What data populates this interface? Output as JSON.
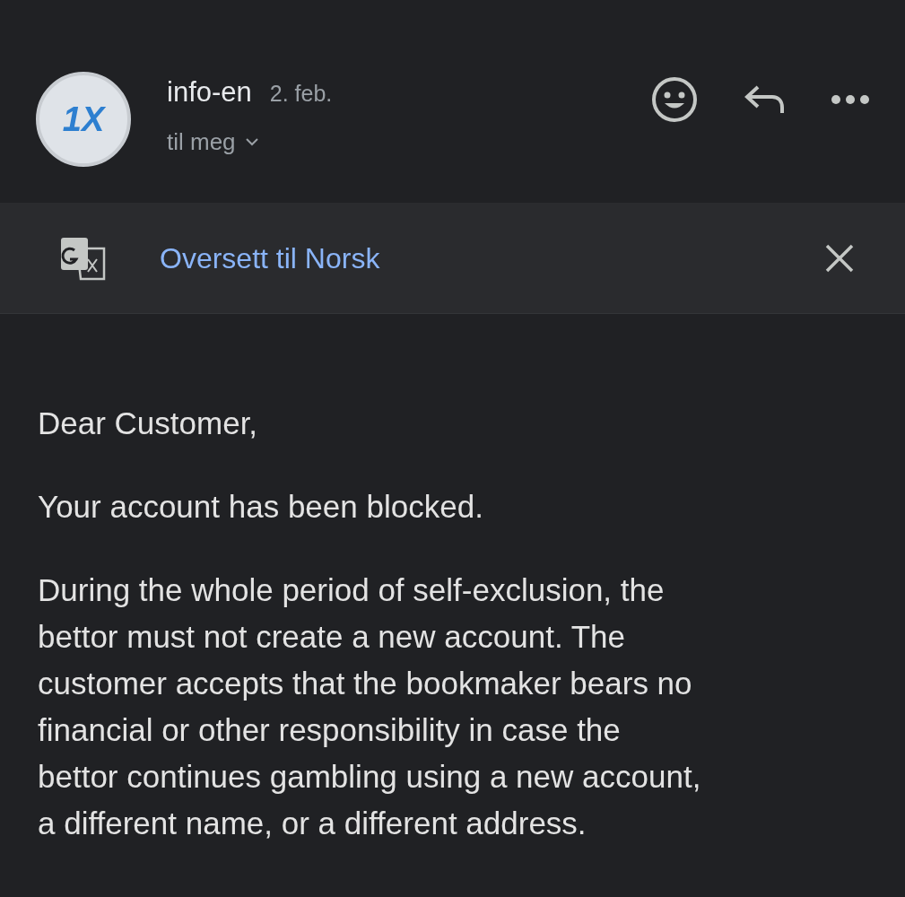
{
  "header": {
    "avatar_text": "1X",
    "sender": "info-en",
    "date": "2. feb.",
    "recipient": "til meg"
  },
  "translate_bar": {
    "link": "Oversett til Norsk"
  },
  "body": {
    "paragraphs": [
      {
        "lines": [
          "Dear Customer,"
        ]
      },
      {
        "lines": [
          "Your account has been blocked."
        ]
      },
      {
        "lines": [
          "During the whole period of self-exclusion, the",
          "bettor must not create a new account. The",
          "customer accepts that the bookmaker bears no",
          "financial or other responsibility in case the",
          "bettor continues gambling using a new account,",
          "a different name, or a different address."
        ]
      }
    ]
  }
}
